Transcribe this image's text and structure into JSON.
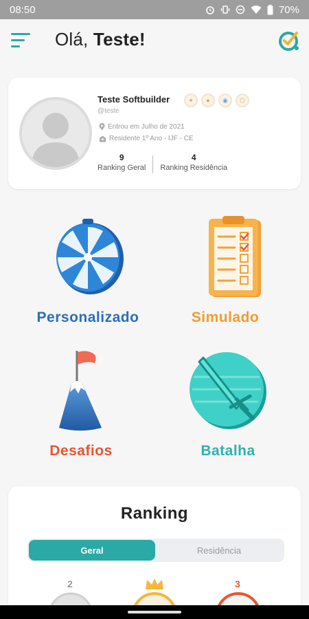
{
  "status_bar": {
    "time": "08:50",
    "battery": "70%",
    "icons": [
      "alarm-icon",
      "vibrate-icon",
      "dnd-icon",
      "wifi-icon",
      "battery-icon"
    ]
  },
  "header": {
    "greeting": "Olá,",
    "user_name": "Teste!"
  },
  "profile": {
    "name": "Teste Softbuilder",
    "handle": "@teste",
    "joined": "Entrou em Julho de 2021",
    "residence": "Residente 1º Ano - IJF - CE",
    "ranking_general_value": "9",
    "ranking_general_label": "Ranking Geral",
    "ranking_residence_value": "4",
    "ranking_residence_label": "Ranking Residência"
  },
  "modes": {
    "personalizado": {
      "label": "Personalizado",
      "color": "#2a6ebd"
    },
    "simulado": {
      "label": "Simulado",
      "color": "#f39c2b"
    },
    "desafios": {
      "label": "Desafios",
      "color": "#e8552f"
    },
    "batalha": {
      "label": "Batalha",
      "color": "#2bb3ad"
    }
  },
  "ranking": {
    "title": "Ranking",
    "tab_general": "Geral",
    "tab_residence": "Residência",
    "podium": [
      "2",
      "3"
    ]
  },
  "colors": {
    "accent": "#2aa9a6"
  }
}
